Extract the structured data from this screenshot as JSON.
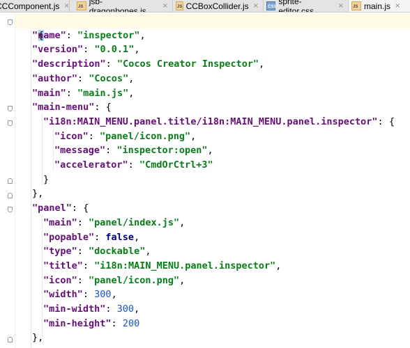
{
  "tabs": [
    {
      "label": "CCComponent.js",
      "type": "js"
    },
    {
      "label": "jsb-dragonbones.js",
      "type": "js"
    },
    {
      "label": "CCBoxCollider.js",
      "type": "js"
    },
    {
      "label": "sprite-editor.css",
      "type": "css"
    },
    {
      "label": "main.js",
      "type": "js"
    }
  ],
  "close_glyph": "×",
  "badges": {
    "js": "JS",
    "css": "CSS"
  },
  "code": {
    "open_brace": "{",
    "close_brace": "}",
    "lines": [
      {
        "key": "\"name\"",
        "value": "\"inspector\"",
        "vtype": "s",
        "tail": ","
      },
      {
        "key": "\"version\"",
        "value": "\"0.0.1\"",
        "vtype": "s",
        "tail": ","
      },
      {
        "key": "\"description\"",
        "value": "\"Cocos Creator Inspector\"",
        "vtype": "s",
        "tail": ","
      },
      {
        "key": "\"author\"",
        "value": "\"Cocos\"",
        "vtype": "s",
        "tail": ","
      },
      {
        "key": "\"main\"",
        "value": "\"main.js\"",
        "vtype": "s",
        "tail": ","
      },
      {
        "key": "\"main-menu\"",
        "value": "{",
        "vtype": "p",
        "tail": ""
      },
      {
        "key": "\"i18n:MAIN_MENU.panel.title/i18n:MAIN_MENU.panel.inspector\"",
        "value": "{",
        "vtype": "p",
        "tail": ""
      },
      {
        "key": "\"icon\"",
        "value": "\"panel/icon.png\"",
        "vtype": "s",
        "tail": ","
      },
      {
        "key": "\"message\"",
        "value": "\"inspector:open\"",
        "vtype": "s",
        "tail": ","
      },
      {
        "key": "\"accelerator\"",
        "value": "\"CmdOrCtrl+3\"",
        "vtype": "s",
        "tail": ""
      },
      {
        "raw": "}"
      },
      {
        "raw": "},"
      },
      {
        "key": "\"panel\"",
        "value": "{",
        "vtype": "p",
        "tail": ""
      },
      {
        "key": "\"main\"",
        "value": "\"panel/index.js\"",
        "vtype": "s",
        "tail": ","
      },
      {
        "key": "\"popable\"",
        "value": "false",
        "vtype": "b",
        "tail": ","
      },
      {
        "key": "\"type\"",
        "value": "\"dockable\"",
        "vtype": "s",
        "tail": ","
      },
      {
        "key": "\"title\"",
        "value": "\"i18n:MAIN_MENU.panel.inspector\"",
        "vtype": "s",
        "tail": ","
      },
      {
        "key": "\"icon\"",
        "value": "\"panel/icon.png\"",
        "vtype": "s",
        "tail": ","
      },
      {
        "key": "\"width\"",
        "value": "300",
        "vtype": "n",
        "tail": ","
      },
      {
        "key": "\"min-width\"",
        "value": "300",
        "vtype": "n",
        "tail": ","
      },
      {
        "key": "\"min-height\"",
        "value": "200",
        "vtype": "n",
        "tail": ""
      },
      {
        "raw": "},"
      }
    ]
  },
  "colors": {
    "key": "#660e7a",
    "string": "#067d17",
    "number": "#1750eb",
    "boolean": "#000080",
    "current_line": "#fffae3"
  }
}
